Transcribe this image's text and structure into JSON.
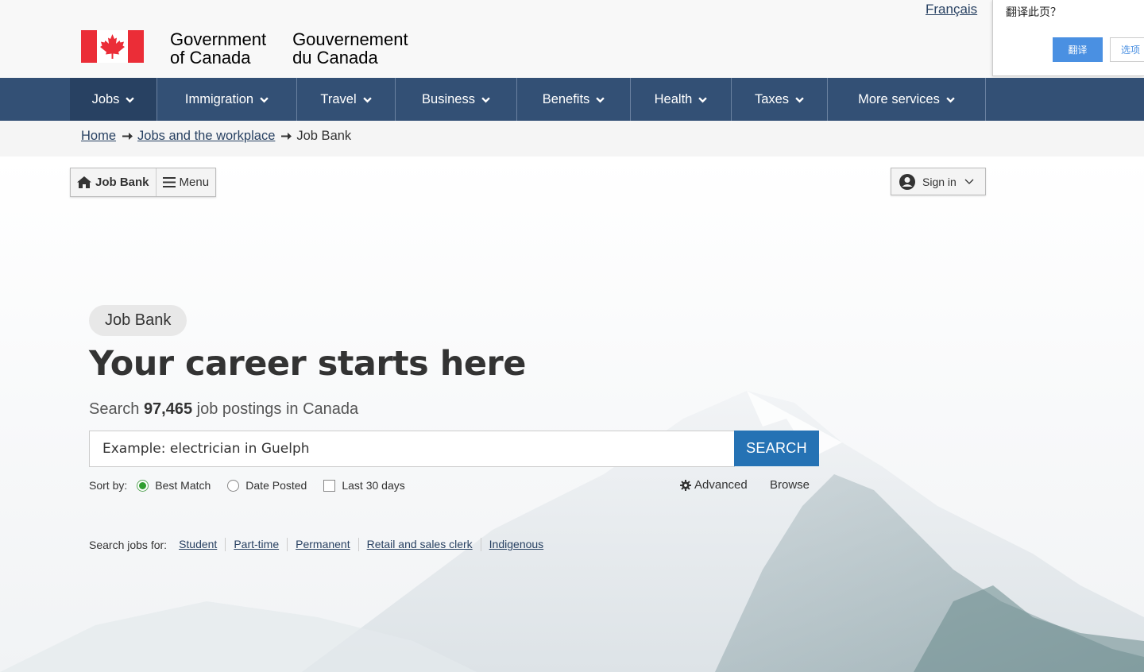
{
  "header": {
    "lang_link": "Français",
    "brand_en_line1": "Government",
    "brand_en_line2": "of Canada",
    "brand_fr_line1": "Gouvernement",
    "brand_fr_line2": "du Canada",
    "flag_icon": "canada-flag-icon"
  },
  "translate_popup": {
    "question": "翻译此页？",
    "translate_button": "翻译",
    "options_button": "选项"
  },
  "nav": {
    "items": [
      {
        "label": "Jobs",
        "active": true
      },
      {
        "label": "Immigration",
        "active": false
      },
      {
        "label": "Travel",
        "active": false
      },
      {
        "label": "Business",
        "active": false
      },
      {
        "label": "Benefits",
        "active": false
      },
      {
        "label": "Health",
        "active": false
      },
      {
        "label": "Taxes",
        "active": false
      },
      {
        "label": "More services",
        "active": false
      }
    ]
  },
  "breadcrumb": {
    "home": "Home",
    "jobs": "Jobs and the workplace",
    "current": "Job Bank"
  },
  "toolbar": {
    "home_label": "Job Bank",
    "menu_label": "Menu",
    "signin_label": "Sign in"
  },
  "hero": {
    "pill": "Job Bank",
    "title": "Your career starts here",
    "sub_prefix": "Search ",
    "sub_count": "97,465",
    "sub_suffix": " job postings in Canada",
    "search_placeholder": "Example: electrician in Guelph",
    "search_button": "SEARCH",
    "sort_label": "Sort by:",
    "sort_best": "Best Match",
    "sort_date": "Date Posted",
    "last30": "Last 30 days",
    "advanced": "Advanced",
    "browse": "Browse",
    "quick_label": "Search jobs for:",
    "quick_links": [
      "Student",
      "Part-time",
      "Permanent",
      "Retail and sales clerk",
      "Indigenous"
    ]
  },
  "colors": {
    "nav_bg": "#335075",
    "nav_active": "#284162",
    "search_button": "#2572b4",
    "link": "#284162"
  }
}
